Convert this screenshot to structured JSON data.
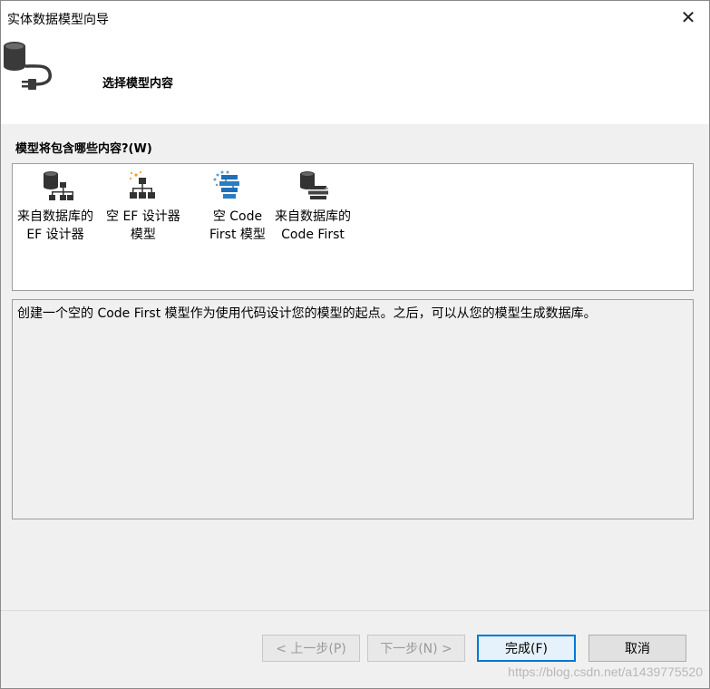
{
  "window": {
    "title": "实体数据模型向导",
    "close": "✕"
  },
  "header": {
    "icon": "database-plug-icon",
    "title": "选择模型内容"
  },
  "question": "模型将包含哪些内容?(W)",
  "list": {
    "items": [
      {
        "label": "来自数据库的\nEF 设计器",
        "icon": "database-hierarchy-icon",
        "selected": false
      },
      {
        "label": "空 EF 设计器\n模型",
        "icon": "empty-hierarchy-icon",
        "selected": false
      },
      {
        "label": "空 Code\nFirst 模型",
        "icon": "code-first-icon",
        "selected": true
      },
      {
        "label": "来自数据库的\nCode First",
        "icon": "database-code-first-icon",
        "selected": false
      }
    ]
  },
  "description": "创建一个空的 Code First 模型作为使用代码设计您的模型的起点。之后，可以从您的模型生成数据库。",
  "buttons": {
    "back": "< 上一步(P)",
    "next": "下一步(N) >",
    "finish": "完成(F)",
    "cancel": "取消"
  },
  "watermark": "https://blog.csdn.net/a1439775520"
}
